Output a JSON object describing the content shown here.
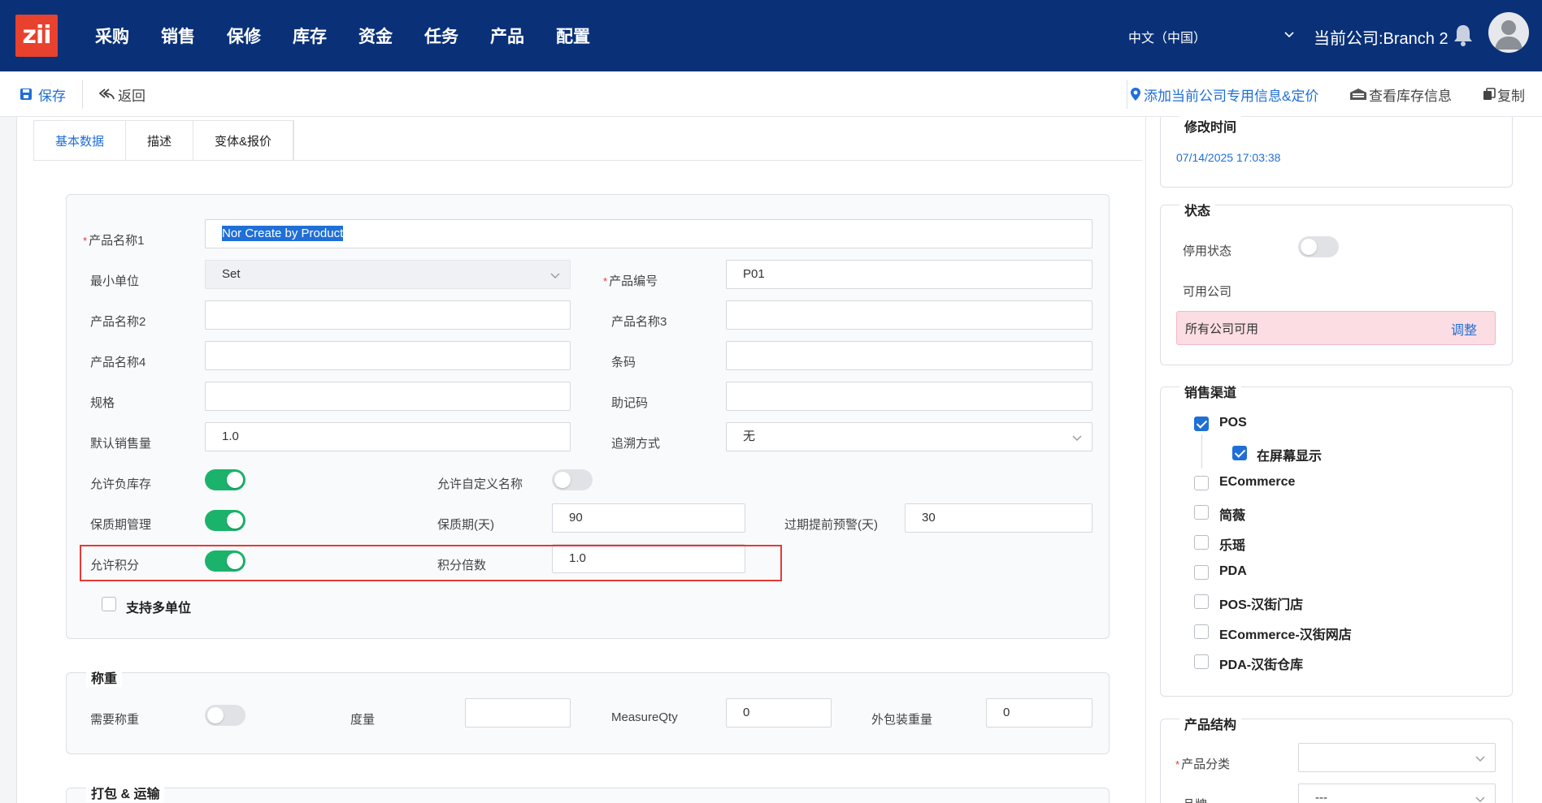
{
  "app": {
    "logo_text": "zii",
    "menu": [
      "采购",
      "销售",
      "保修",
      "库存",
      "资金",
      "任务",
      "产品",
      "配置"
    ],
    "language": "中文（中国）",
    "company": "当前公司:Branch 2"
  },
  "toolbar": {
    "save": "保存",
    "back": "返回",
    "add_company_info": "添加当前公司专用信息&定价",
    "view_stock": "查看库存信息",
    "copy": "复制"
  },
  "tabs": [
    "基本数据",
    "描述",
    "变体&报价"
  ],
  "basic": {
    "product_name1_label": "产品名称1",
    "product_name1_value": "Nor Create by Product",
    "min_unit_label": "最小单位",
    "min_unit_value": "Set",
    "product_code_label": "产品编号",
    "product_code_value": "P01",
    "product_name2_label": "产品名称2",
    "product_name2_value": "",
    "product_name3_label": "产品名称3",
    "product_name3_value": "",
    "product_name4_label": "产品名称4",
    "product_name4_value": "",
    "barcode_label": "条码",
    "barcode_value": "",
    "spec_label": "规格",
    "spec_value": "",
    "mnemonic_label": "助记码",
    "mnemonic_value": "",
    "default_qty_label": "默认销售量",
    "default_qty_value": "1.0",
    "tracking_label": "追溯方式",
    "tracking_value": "无",
    "allow_negative_label": "允许负库存",
    "allow_negative_on": true,
    "allow_custom_name_label": "允许自定义名称",
    "allow_custom_name_on": false,
    "shelf_life_mgmt_label": "保质期管理",
    "shelf_life_mgmt_on": true,
    "shelf_life_days_label": "保质期(天)",
    "shelf_life_days_value": "90",
    "expiry_warning_label": "过期提前预警(天)",
    "expiry_warning_value": "30",
    "allow_points_label": "允许积分",
    "allow_points_on": true,
    "points_multiplier_label": "积分倍数",
    "points_multiplier_value": "1.0",
    "multi_unit_label": "支持多单位",
    "multi_unit_checked": false
  },
  "weighing": {
    "title": "称重",
    "need_weigh_label": "需要称重",
    "need_weigh_on": false,
    "measure_label": "度量",
    "measure_value": "",
    "measure_qty_label": "MeasureQty",
    "measure_qty_value": "0",
    "outer_weight_label": "外包装重量",
    "outer_weight_value": "0"
  },
  "packing": {
    "title": "打包 & 运输"
  },
  "right": {
    "modified_title": "修改时间",
    "modified_value": "07/14/2025 17:03:38",
    "status_title": "状态",
    "disabled_label": "停用状态",
    "disabled_on": false,
    "available_company_label": "可用公司",
    "all_companies": "所有公司可用",
    "adjust": "调整",
    "channels_title": "销售渠道",
    "channels": [
      {
        "label": "POS",
        "checked": true
      },
      {
        "label": "在屏幕显示",
        "checked": true
      },
      {
        "label": "ECommerce",
        "checked": false
      },
      {
        "label": "简薇",
        "checked": false
      },
      {
        "label": "乐瑶",
        "checked": false
      },
      {
        "label": "PDA",
        "checked": false
      },
      {
        "label": "POS-汉街门店",
        "checked": false
      },
      {
        "label": "ECommerce-汉街网店",
        "checked": false
      },
      {
        "label": "PDA-汉街仓库",
        "checked": false
      }
    ],
    "structure_title": "产品结构",
    "category_label": "产品分类",
    "category_value": "",
    "brand_label": "品牌",
    "brand_value": "---"
  },
  "colors": {
    "nav_bg": "#0a3178",
    "accent": "#1f6fd6",
    "toggle_on": "#1bb36b",
    "highlight_border": "#e53935",
    "logo_bg": "#e8412e"
  }
}
